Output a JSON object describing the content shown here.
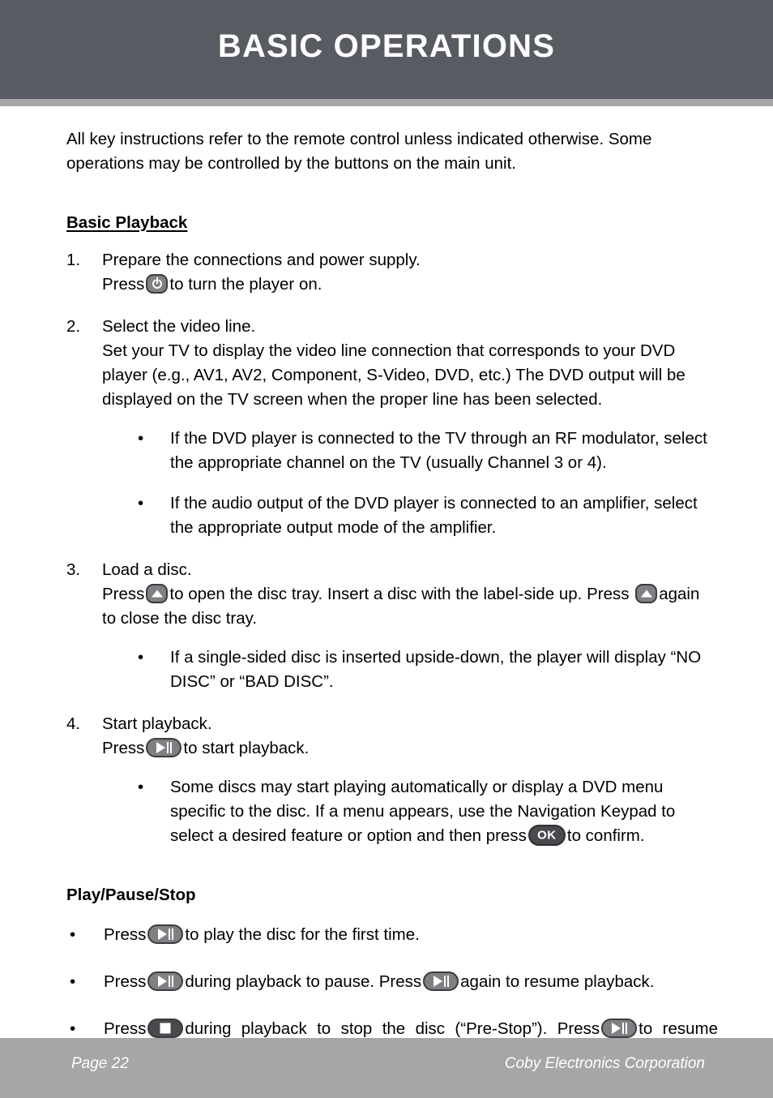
{
  "header": {
    "title": "BASIC OPERATIONS",
    "background_color": "#585C62",
    "rule_color": "#A6A6A8",
    "title_color": "#FFFFFF"
  },
  "content": {
    "intro": "All key instructions refer to the remote control unless indicated otherwise. Some operations may be controlled by the buttons on the main unit.",
    "basic_playback": {
      "heading": "Basic Playback",
      "steps": [
        {
          "number": "1.",
          "line1": "Prepare the connections and power supply.",
          "line2_before": "Press",
          "icon": "power-icon",
          "line2_after": "to turn the player on."
        },
        {
          "number": "2.",
          "line1": "Select the video line.",
          "body": "Set your TV to display the video line connection that corresponds to your DVD player (e.g., AV1, AV2, Component, S-Video, DVD, etc.) The DVD output will be displayed on the TV screen when the proper line has been selected.",
          "bullets": [
            {
              "marker": "•",
              "text": "If the DVD player is connected to the TV through an RF modulator, select the appropriate channel on the TV (usually Channel 3 or 4)."
            },
            {
              "marker": "•",
              "text": "If the audio output of the DVD player is connected to an amplifier, select the appropriate output mode of the amplifier."
            }
          ]
        },
        {
          "number": "3.",
          "line1": "Load a disc.",
          "seg1": "Press",
          "icon1": "eject-icon",
          "seg2": "to open the disc tray. Insert a disc with the label-side up. Press",
          "icon2": "eject-icon",
          "seg3": "again to close the disc tray.",
          "bullets": [
            {
              "marker": "•",
              "text": "If a single-sided disc is inserted upside-down, the player will display “NO DISC” or “BAD DISC”."
            }
          ]
        },
        {
          "number": "4.",
          "line1": "Start playback.",
          "seg1": "Press",
          "icon1": "play-pause-icon",
          "seg2": "to start playback.",
          "bullets": [
            {
              "marker": "•",
              "seg1": "Some discs may start playing automatically or display a DVD menu specific to the disc. If a menu appears, use the Navigation Keypad to select a desired feature or option and then press",
              "icon": "ok-button-icon",
              "seg2": "to confirm."
            }
          ]
        }
      ]
    },
    "play_pause_stop": {
      "heading": "Play/Pause/Stop",
      "bullets": [
        {
          "marker": "•",
          "seg1": "Press",
          "icon1": "play-pause-icon",
          "seg2": "to play the disc for the first time."
        },
        {
          "marker": "•",
          "seg1": "Press",
          "icon1": "play-pause-icon",
          "seg2": "during playback to pause. Press",
          "icon2": "play-pause-icon",
          "seg3": "again to resume playback."
        },
        {
          "marker": "•",
          "seg1": "Press",
          "icon1": "stop-icon",
          "seg2": "during playback to stop the disc (“Pre-Stop”). Press",
          "icon2": "play-pause-icon",
          "seg3": "to",
          "seg4": "resume playback at the time-point at which the disc was stopped."
        }
      ]
    }
  },
  "footer": {
    "page_label": "Page 22",
    "company": "Coby Electronics Corporation",
    "background_color": "#A6A6A8",
    "text_color": "#FFFFFF"
  },
  "icons": {
    "ok_label": "OK"
  }
}
